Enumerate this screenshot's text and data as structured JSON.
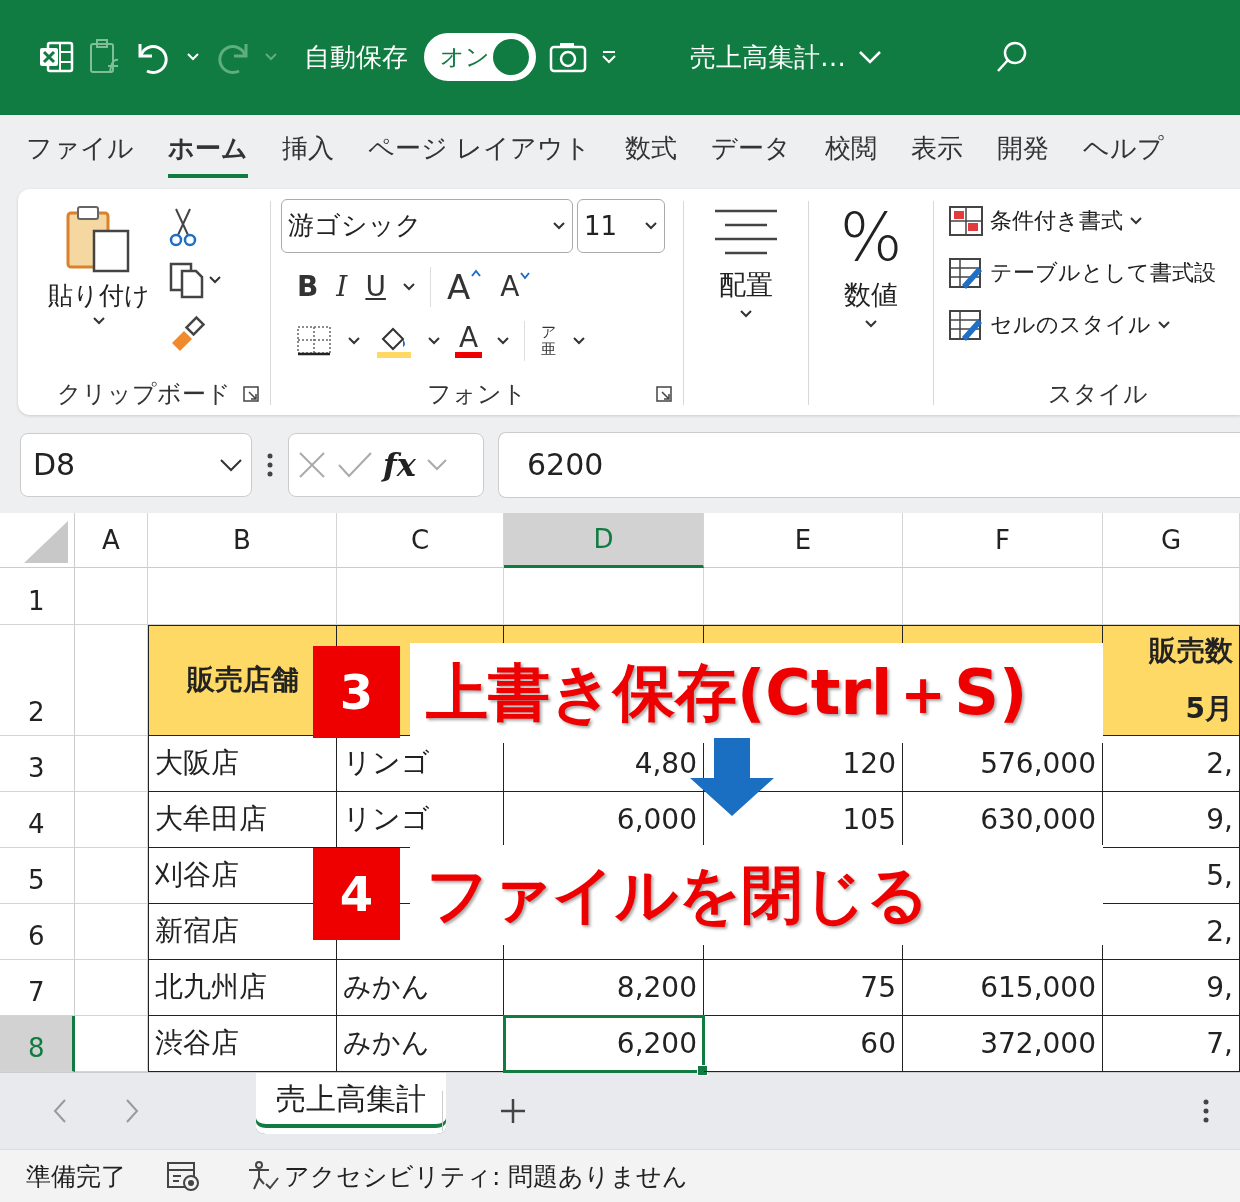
{
  "title_bar": {
    "autosave_label": "自動保存",
    "autosave": {
      "label": "オン",
      "on": true
    },
    "document_title": "売上高集計…"
  },
  "ribbon_tabs": [
    {
      "label": "ファイル",
      "selected": false
    },
    {
      "label": "ホーム",
      "selected": true
    },
    {
      "label": "挿入",
      "selected": false
    },
    {
      "label": "ページ レイアウト",
      "selected": false
    },
    {
      "label": "数式",
      "selected": false
    },
    {
      "label": "データ",
      "selected": false
    },
    {
      "label": "校閲",
      "selected": false
    },
    {
      "label": "表示",
      "selected": false
    },
    {
      "label": "開発",
      "selected": false
    },
    {
      "label": "ヘルプ",
      "selected": false
    }
  ],
  "ribbon": {
    "clipboard": {
      "paste_label": "貼り付け",
      "group_label": "クリップボード"
    },
    "font": {
      "font_name": "游ゴシック",
      "font_size": "11",
      "bold": "B",
      "italic": "I",
      "underline": "U",
      "grow": "A",
      "shrink": "A",
      "font_color": "A",
      "phonetic_top": "ア",
      "phonetic_bottom": "亜",
      "group_label": "フォント"
    },
    "alignment": {
      "label": "配置"
    },
    "number": {
      "symbol": "%",
      "label": "数値"
    },
    "styles": {
      "items": [
        {
          "label": "条件付き書式",
          "dropdown": true
        },
        {
          "label": "テーブルとして書式設",
          "dropdown": false
        },
        {
          "label": "セルのスタイル",
          "dropdown": true
        }
      ],
      "group_label": "スタイル"
    }
  },
  "formula_bar": {
    "name_box": "D8",
    "function_label": "fx",
    "formula": "6200"
  },
  "sheet": {
    "columns": [
      {
        "label": "A",
        "kind": "text",
        "selected": false
      },
      {
        "label": "B",
        "kind": "text",
        "selected": false
      },
      {
        "label": "C",
        "kind": "text",
        "selected": false
      },
      {
        "label": "D",
        "kind": "number",
        "selected": true
      },
      {
        "label": "E",
        "kind": "number",
        "selected": false
      },
      {
        "label": "F",
        "kind": "number",
        "selected": false
      },
      {
        "label": "G",
        "kind": "number",
        "selected": false
      }
    ],
    "rows": [
      {
        "label": "1",
        "kind": "plain",
        "selected": false,
        "cells": {}
      },
      {
        "label": "2",
        "kind": "header",
        "selected": false,
        "cells": {
          "B": "販売店舗",
          "G": [
            "販売数",
            "5月"
          ]
        }
      },
      {
        "label": "3",
        "kind": "data",
        "selected": false,
        "cells": {
          "B": "大阪店",
          "C": "リンゴ",
          "D": "4,80",
          "E": "120",
          "F": "576,000",
          "G": "2,"
        }
      },
      {
        "label": "4",
        "kind": "data",
        "selected": false,
        "cells": {
          "B": "大牟田店",
          "C": "リンゴ",
          "D": "6,000",
          "E": "105",
          "F": "630,000",
          "G": "9,"
        }
      },
      {
        "label": "5",
        "kind": "data",
        "selected": false,
        "cells": {
          "B": "刈谷店",
          "G": "5,"
        }
      },
      {
        "label": "6",
        "kind": "data",
        "selected": false,
        "cells": {
          "B": "新宿店",
          "G": "2,"
        }
      },
      {
        "label": "7",
        "kind": "data",
        "selected": false,
        "cells": {
          "B": "北九州店",
          "C": "みかん",
          "D": "8,200",
          "E": "75",
          "F": "615,000",
          "G": "9,"
        }
      },
      {
        "label": "8",
        "kind": "data",
        "selected": true,
        "cells": {
          "B": "渋谷店",
          "C": "みかん",
          "D": "6,200",
          "E": "60",
          "F": "372,000",
          "G": "7,"
        }
      }
    ]
  },
  "annotations": [
    {
      "step": "3",
      "text": "上書き保存(Ctrl＋S)"
    },
    {
      "step": "4",
      "text": "ファイルを閉じる"
    }
  ],
  "sheet_tabs": [
    {
      "label": "売上高集計",
      "selected": true
    }
  ],
  "status_bar": {
    "ready": "準備完了",
    "accessibility": "アクセシビリティ: 問題ありません"
  }
}
